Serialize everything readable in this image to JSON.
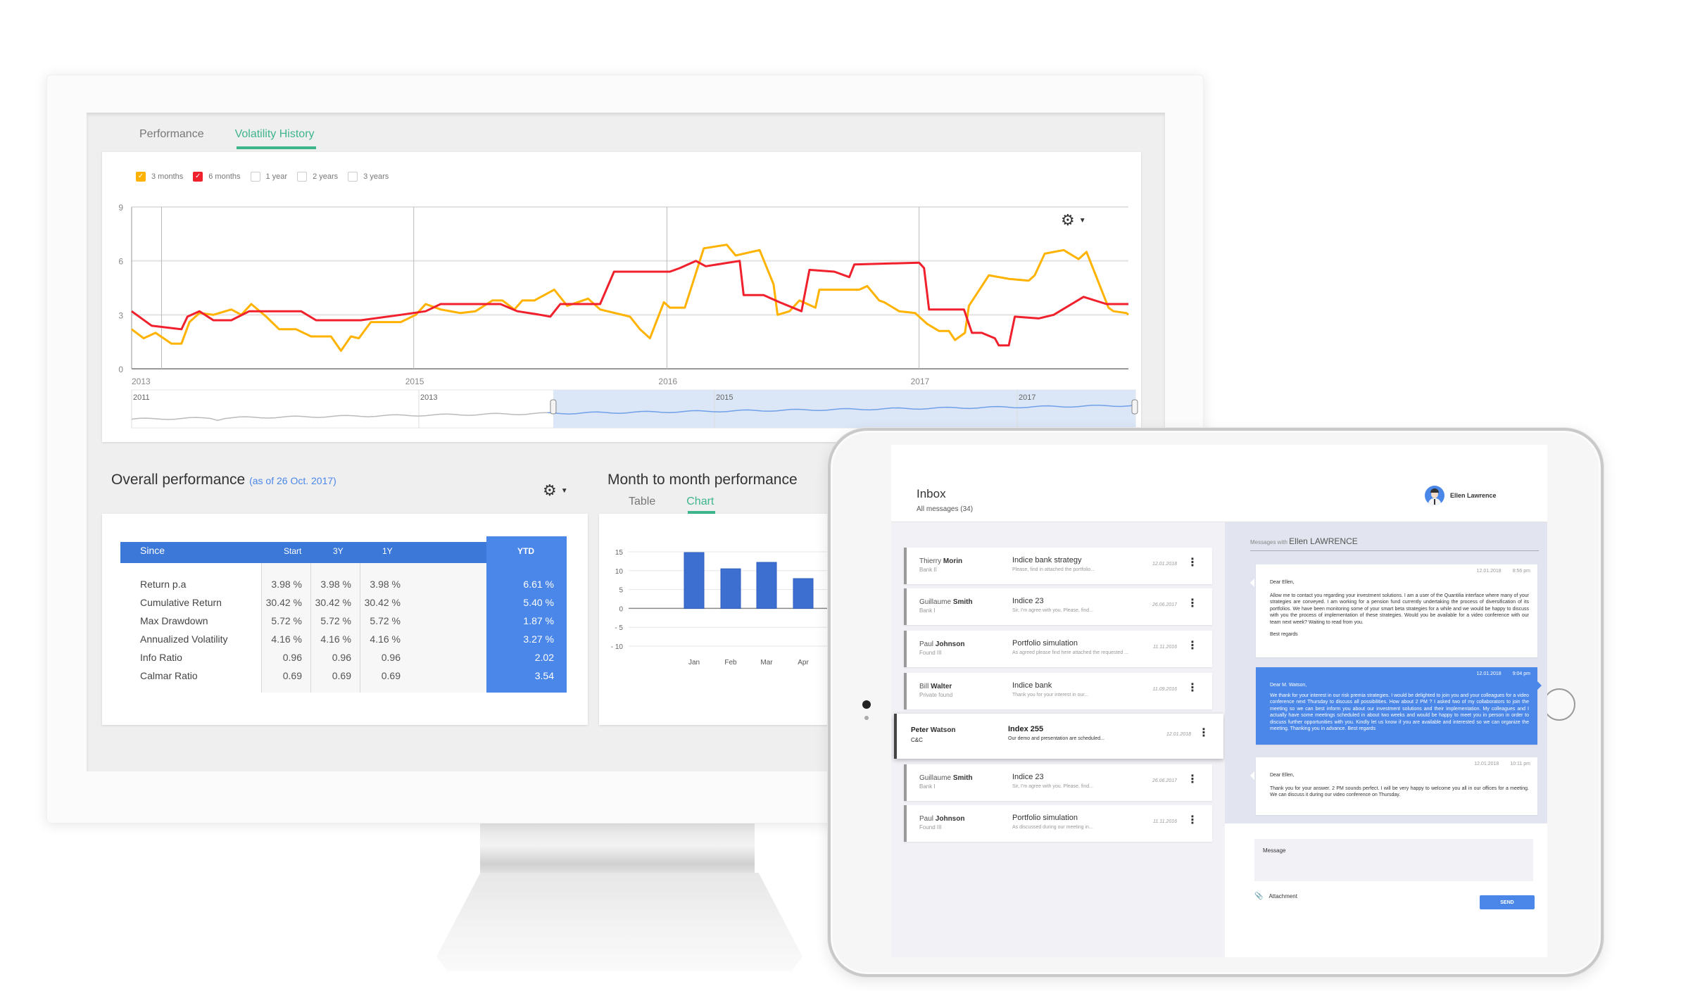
{
  "colors": {
    "accent_green": "#3fb58b",
    "series_3m": "#ffb300",
    "series_6m": "#f0202c",
    "primary_blue": "#3c78d8",
    "ytd_blue": "#4a87e8",
    "bar_blue": "#3c6fcf"
  },
  "dashboard": {
    "tabs": [
      {
        "label": "Performance",
        "active": false
      },
      {
        "label": "Volatility History",
        "active": true
      }
    ],
    "legend": [
      {
        "label": "3 months",
        "checked": true,
        "color": "#ffb300"
      },
      {
        "label": "6 months",
        "checked": true,
        "color": "#f0202c"
      },
      {
        "label": "1 year",
        "checked": false
      },
      {
        "label": "2 years",
        "checked": false
      },
      {
        "label": "3 years",
        "checked": false
      }
    ],
    "settings_icon": "gear-icon",
    "overall": {
      "title": "Overall performance",
      "subtitle": "(as of 26 Oct. 2017)",
      "columns": [
        "Since",
        "Start",
        "3Y",
        "1Y",
        "YTD"
      ],
      "rows": [
        {
          "label": "Return p.a",
          "values": [
            "3.98 %",
            "3.98 %",
            "3.98 %",
            "6.61 %"
          ]
        },
        {
          "label": "Cumulative Return",
          "values": [
            "30.42 %",
            "30.42 %",
            "30.42 %",
            "5.40 %"
          ]
        },
        {
          "label": "Max Drawdown",
          "values": [
            "5.72 %",
            "5.72 %",
            "5.72 %",
            "1.87 %"
          ]
        },
        {
          "label": "Annualized Volatility",
          "values": [
            "4.16 %",
            "4.16 %",
            "4.16 %",
            "3.27 %"
          ]
        },
        {
          "label": "Info Ratio",
          "values": [
            "0.96",
            "0.96",
            "0.96",
            "2.02"
          ]
        },
        {
          "label": "Calmar Ratio",
          "values": [
            "0.69",
            "0.69",
            "0.69",
            "3.54"
          ]
        }
      ]
    },
    "mtm": {
      "title": "Month to month performance",
      "tabs": [
        {
          "label": "Table",
          "active": false
        },
        {
          "label": "Chart",
          "active": true
        }
      ]
    }
  },
  "chart_data": [
    {
      "type": "line",
      "title": "Volatility History",
      "ylim": [
        0,
        9
      ],
      "yticks": [
        0,
        3,
        6,
        9
      ],
      "xticks": [
        {
          "label": "2013",
          "t": 0.0
        },
        {
          "label": "2015",
          "t": 0.283
        },
        {
          "label": "2016",
          "t": 0.537
        },
        {
          "label": "2017",
          "t": 0.79
        }
      ],
      "grid": true,
      "series": [
        {
          "name": "3 months",
          "color": "#ffb300",
          "points": [
            [
              0,
              2.2
            ],
            [
              0.012,
              1.7
            ],
            [
              0.024,
              2.0
            ],
            [
              0.04,
              1.4
            ],
            [
              0.05,
              1.4
            ],
            [
              0.058,
              2.6
            ],
            [
              0.068,
              3.1
            ],
            [
              0.082,
              3.0
            ],
            [
              0.1,
              3.3
            ],
            [
              0.11,
              3.0
            ],
            [
              0.12,
              3.6
            ],
            [
              0.135,
              2.9
            ],
            [
              0.148,
              2.2
            ],
            [
              0.165,
              2.2
            ],
            [
              0.18,
              1.8
            ],
            [
              0.2,
              1.8
            ],
            [
              0.21,
              1.0
            ],
            [
              0.22,
              1.8
            ],
            [
              0.228,
              1.7
            ],
            [
              0.24,
              2.6
            ],
            [
              0.27,
              2.6
            ],
            [
              0.285,
              3.0
            ],
            [
              0.295,
              3.6
            ],
            [
              0.31,
              3.3
            ],
            [
              0.33,
              3.1
            ],
            [
              0.345,
              3.2
            ],
            [
              0.362,
              3.8
            ],
            [
              0.372,
              3.8
            ],
            [
              0.384,
              3.3
            ],
            [
              0.392,
              3.8
            ],
            [
              0.404,
              3.8
            ],
            [
              0.424,
              4.4
            ],
            [
              0.437,
              3.5
            ],
            [
              0.458,
              3.9
            ],
            [
              0.47,
              3.3
            ],
            [
              0.5,
              2.9
            ],
            [
              0.51,
              2.2
            ],
            [
              0.52,
              1.7
            ],
            [
              0.534,
              3.7
            ],
            [
              0.54,
              3.4
            ],
            [
              0.555,
              3.4
            ],
            [
              0.574,
              6.7
            ],
            [
              0.597,
              6.9
            ],
            [
              0.606,
              6.3
            ],
            [
              0.63,
              6.6
            ],
            [
              0.644,
              4.7
            ],
            [
              0.648,
              3.0
            ],
            [
              0.66,
              3.2
            ],
            [
              0.67,
              3.8
            ],
            [
              0.686,
              3.4
            ],
            [
              0.69,
              4.4
            ],
            [
              0.7,
              4.4
            ],
            [
              0.73,
              4.4
            ],
            [
              0.738,
              4.6
            ],
            [
              0.75,
              3.8
            ],
            [
              0.755,
              3.7
            ],
            [
              0.77,
              3.2
            ],
            [
              0.786,
              3.1
            ],
            [
              0.798,
              2.5
            ],
            [
              0.81,
              2.1
            ],
            [
              0.82,
              2.1
            ],
            [
              0.826,
              1.6
            ],
            [
              0.836,
              2.0
            ],
            [
              0.84,
              3.5
            ],
            [
              0.86,
              5.2
            ],
            [
              0.88,
              5.0
            ],
            [
              0.9,
              4.9
            ],
            [
              0.906,
              5.2
            ],
            [
              0.916,
              6.4
            ],
            [
              0.935,
              6.6
            ],
            [
              0.95,
              6.1
            ],
            [
              0.958,
              6.5
            ],
            [
              0.98,
              3.4
            ],
            [
              0.985,
              3.2
            ],
            [
              0.998,
              3.1
            ],
            [
              1.0,
              3.0
            ]
          ]
        },
        {
          "name": "6 months",
          "color": "#f0202c",
          "points": [
            [
              0,
              3.2
            ],
            [
              0.02,
              2.4
            ],
            [
              0.05,
              2.2
            ],
            [
              0.056,
              2.9
            ],
            [
              0.068,
              3.2
            ],
            [
              0.082,
              2.7
            ],
            [
              0.1,
              2.7
            ],
            [
              0.118,
              3.2
            ],
            [
              0.17,
              3.2
            ],
            [
              0.185,
              2.7
            ],
            [
              0.23,
              2.7
            ],
            [
              0.27,
              3.0
            ],
            [
              0.295,
              3.2
            ],
            [
              0.31,
              3.6
            ],
            [
              0.37,
              3.6
            ],
            [
              0.387,
              3.2
            ],
            [
              0.41,
              3.0
            ],
            [
              0.42,
              2.9
            ],
            [
              0.43,
              3.6
            ],
            [
              0.47,
              3.6
            ],
            [
              0.484,
              5.4
            ],
            [
              0.54,
              5.4
            ],
            [
              0.55,
              5.6
            ],
            [
              0.566,
              6.0
            ],
            [
              0.576,
              5.7
            ],
            [
              0.61,
              6.0
            ],
            [
              0.614,
              4.1
            ],
            [
              0.634,
              4.1
            ],
            [
              0.65,
              3.7
            ],
            [
              0.672,
              3.2
            ],
            [
              0.68,
              5.5
            ],
            [
              0.705,
              5.4
            ],
            [
              0.72,
              5.1
            ],
            [
              0.725,
              5.8
            ],
            [
              0.79,
              5.9
            ],
            [
              0.795,
              5.6
            ],
            [
              0.8,
              3.3
            ],
            [
              0.835,
              3.3
            ],
            [
              0.843,
              2.0
            ],
            [
              0.853,
              2.0
            ],
            [
              0.866,
              1.7
            ],
            [
              0.87,
              1.3
            ],
            [
              0.88,
              1.3
            ],
            [
              0.886,
              2.9
            ],
            [
              0.91,
              2.8
            ],
            [
              0.925,
              3.0
            ],
            [
              0.955,
              4.0
            ],
            [
              0.978,
              3.6
            ],
            [
              1.0,
              3.6
            ]
          ]
        }
      ],
      "navigator": {
        "labels": [
          "2011",
          "2013",
          "2015",
          "2017"
        ],
        "selected_range": [
          0.42,
          1.0
        ]
      }
    },
    {
      "type": "bar",
      "title": "Month to month performance",
      "categories": [
        "Jan",
        "Feb",
        "Mar",
        "Apr"
      ],
      "values": [
        14.8,
        10.5,
        12.2,
        7.9
      ],
      "ylim": [
        -10,
        15
      ],
      "yticks": [
        15,
        10,
        5,
        0,
        -5,
        -10
      ],
      "ytick_labels": [
        "15",
        "10",
        "5",
        "0",
        "- 5",
        "- 10"
      ],
      "grid": true
    }
  ],
  "inbox": {
    "title": "Inbox",
    "subtitle": "All messages (34)",
    "user": {
      "name": "Ellen Lawrence",
      "icon": "avatar-icon"
    },
    "messages": [
      {
        "first": "Thierry",
        "last": "Morin",
        "org": "Bank II",
        "subject": "Indice bank strategy",
        "preview": "Please, find in attached the portfolio...",
        "date": "12.01.2018",
        "selected": false
      },
      {
        "first": "Guillaume",
        "last": "Smith",
        "org": "Bank I",
        "subject": "Indice 23",
        "preview": "Sir, I'm agree with you. Please, find...",
        "date": "26.06.2017",
        "selected": false
      },
      {
        "first": "Paul",
        "last": "Johnson",
        "org": "Found III",
        "subject": "Portfolio simulation",
        "preview": "As agreed please find here attached the requested ...",
        "date": "11.11.2016",
        "selected": false
      },
      {
        "first": "Bill",
        "last": "Walter",
        "org": "Private found",
        "subject": "Indice bank",
        "preview": "Thank you for your interest in our...",
        "date": "11.09.2016",
        "selected": false
      },
      {
        "first": "Peter",
        "last": "Watson",
        "org": "C&C",
        "subject": "Index 255",
        "preview": "Our demo and presentation are scheduled...",
        "date": "12.01.2018",
        "selected": true
      },
      {
        "first": "Guillaume",
        "last": "Smith",
        "org": "Bank I",
        "subject": "Indice 23",
        "preview": "Sir, I'm agree with you. Please, find...",
        "date": "26.06.2017",
        "selected": false
      },
      {
        "first": "Paul",
        "last": "Johnson",
        "org": "Found III",
        "subject": "Portfolio simulation",
        "preview": "As discussed during our meeting in...",
        "date": "11.11.2016",
        "selected": false
      }
    ],
    "conversation": {
      "with_label": "Messages with",
      "with_name": "Ellen LAWRENCE",
      "bubbles": [
        {
          "date": "12.01.2018",
          "time": "8:56 pm",
          "mine": false,
          "greeting": "Dear Ellen,",
          "body": "Allow me to contact you regarding your investment solutions. I am a user of the Quantilia interface where many of your strategies are conveyed. I am working for a pension fund currently undertaking the process of diversification of its portfolios. We have been monitoring some of  your smart beta strategies for a while and we would be happy to discuss with you the process of implementation of these strategies. Would you be available for a video conference with our team next week? Waiting to read from you.",
          "sign": "Best regards"
        },
        {
          "date": "12.01.2018",
          "time": "9:04 pm",
          "mine": true,
          "greeting": "Dear M. Watson,",
          "body": "We thank for your interest in our risk premia strategies.  I would be delighted to join you and your colleagues for a video conference next Thursday to discuss all possibilities. How about 2 PM ? I asked two of my collaborators to join the meeting  so we can best inform you about our investment solutions and their implementation. My colleagues and I actually have some meetings scheduled in about two weeks and would be happy to meet you in person in order to discuss further opportunities with you. Kindly let us know if you are available and interested so we can organize the meeting. Thanking you in advance. Best regards",
          "sign": ""
        },
        {
          "date": "12.01.2018",
          "time": "10:11 pm",
          "mine": false,
          "greeting": "Dear Ellen,",
          "body": "Thank you for your answer. 2 PM sounds perfect.  I will be very happy to welcome you all in our offices for a meeting. We can discuss it during our video conference on Thursday.",
          "sign": ""
        }
      ]
    },
    "compose": {
      "placeholder": "Message",
      "attachment_label": "Attachment",
      "send_label": "SEND"
    }
  }
}
